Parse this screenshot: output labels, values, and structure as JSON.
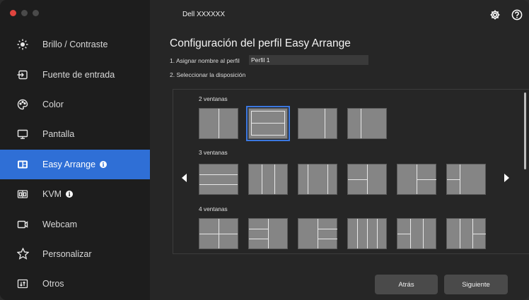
{
  "window": {
    "monitor_name": "Dell XXXXXX",
    "icons": [
      "gear-icon",
      "help-icon"
    ]
  },
  "sidebar": {
    "items": [
      {
        "label": "Brillo / Contraste",
        "icon": "sun-icon",
        "active": false,
        "info": false
      },
      {
        "label": "Fuente de entrada",
        "icon": "input-source-icon",
        "active": false,
        "info": false
      },
      {
        "label": "Color",
        "icon": "palette-icon",
        "active": false,
        "info": false
      },
      {
        "label": "Pantalla",
        "icon": "monitor-icon",
        "active": false,
        "info": false
      },
      {
        "label": "Easy Arrange",
        "icon": "easy-arrange-icon",
        "active": true,
        "info": true
      },
      {
        "label": "KVM",
        "icon": "kvm-icon",
        "active": false,
        "info": true
      },
      {
        "label": "Webcam",
        "icon": "webcam-icon",
        "active": false,
        "info": false
      },
      {
        "label": "Personalizar",
        "icon": "star-icon",
        "active": false,
        "info": false
      },
      {
        "label": "Otros",
        "icon": "others-icon",
        "active": false,
        "info": false
      }
    ]
  },
  "main": {
    "title": "Configuración del perfil Easy Arrange",
    "step1_label": "1. Asignar nombre al perfil",
    "profile_name": "Perfil 1",
    "step2_label": "2. Seleccionar la disposición",
    "groups": [
      {
        "title": "2 ventanas"
      },
      {
        "title": "3 ventanas"
      },
      {
        "title": "4 ventanas"
      }
    ],
    "selected_layout": "2 ventanas, layout 2",
    "back_label": "Atrás",
    "next_label": "Siguiente"
  },
  "colors": {
    "accent": "#2f6fd6",
    "sidebar_bg": "#1d1d1d",
    "content_bg": "#262626",
    "thumb_fill": "#858585",
    "thumb_line": "#e8e8e8"
  }
}
